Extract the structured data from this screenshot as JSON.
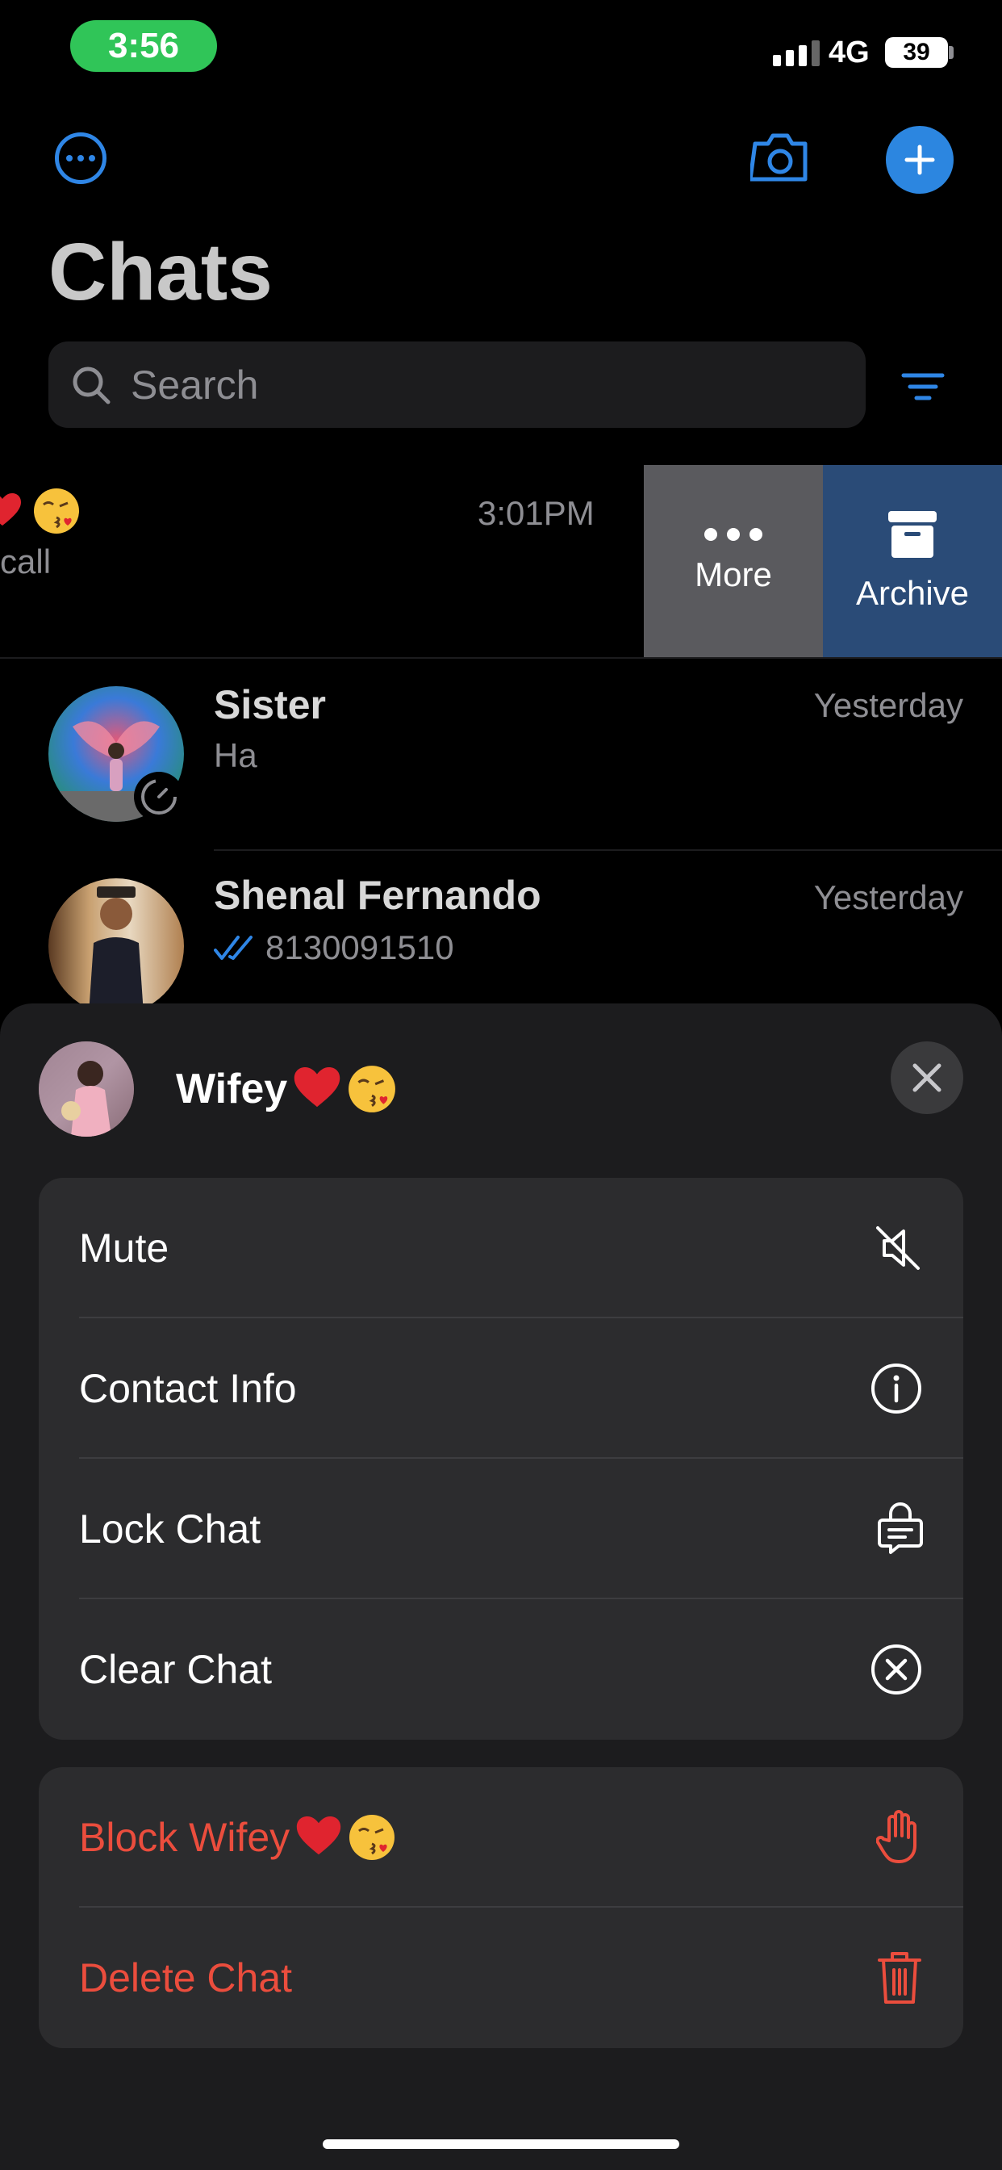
{
  "status_bar": {
    "time": "3:56",
    "network": "4G",
    "battery": "39"
  },
  "header": {
    "title": "Chats",
    "search_placeholder": "Search"
  },
  "swiped_row": {
    "preview": "call",
    "time": "3:01PM",
    "more_label": "More",
    "archive_label": "Archive"
  },
  "chats": [
    {
      "name": "Sister",
      "preview": "Ha",
      "time": "Yesterday"
    },
    {
      "name": "Shenal Fernando",
      "preview": "8130091510",
      "time": "Yesterday"
    }
  ],
  "sheet": {
    "contact_name": "Wifey",
    "actions": [
      {
        "label": "Mute",
        "icon": "muted-speaker-icon"
      },
      {
        "label": "Contact Info",
        "icon": "info-icon"
      },
      {
        "label": "Lock Chat",
        "icon": "lock-chat-icon"
      },
      {
        "label": "Clear Chat",
        "icon": "clear-circle-icon"
      }
    ],
    "destructive": [
      {
        "label": "Block Wifey",
        "icon": "hand-icon"
      },
      {
        "label": "Delete Chat",
        "icon": "trash-icon"
      }
    ]
  },
  "colors": {
    "accent": "#2c86e0",
    "destructive": "#eb4d3d",
    "sheet_bg": "#1c1c1e",
    "group_bg": "#2c2c2e"
  }
}
